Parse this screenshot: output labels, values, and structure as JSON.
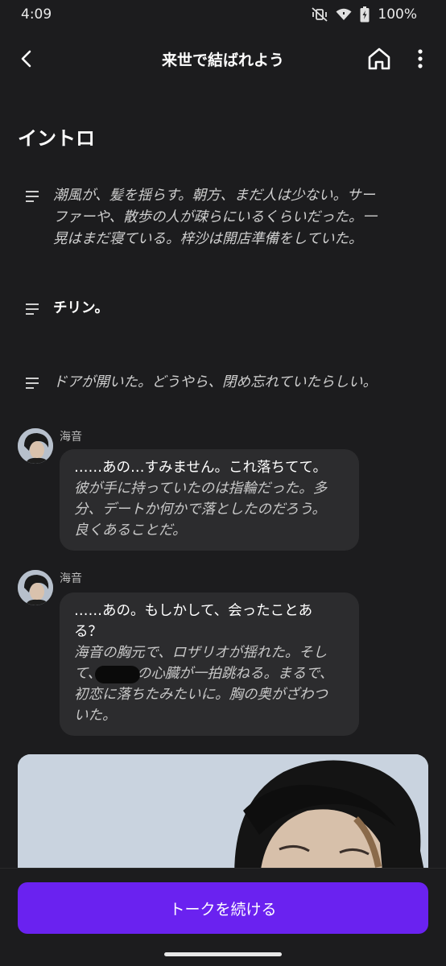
{
  "status_bar": {
    "time": "4:09",
    "battery": "100%",
    "icons": [
      "mute-vibrate-icon",
      "wifi-icon",
      "battery-icon"
    ]
  },
  "header": {
    "title": "来世で結ばれよう",
    "icons": [
      "back-arrow-icon",
      "home-icon",
      "more-vertical-icon"
    ]
  },
  "section": {
    "heading": "イントロ"
  },
  "narration": [
    {
      "lines": [
        "潮風が、髪を揺らす。朝方、まだ人は少ない。サー",
        "ファーや、散歩の人が疎らにいるくらいだった。一",
        "晃はまだ寝ている。梓沙は開店準備をしていた。"
      ]
    },
    {
      "lines": [
        "チリン。"
      ]
    },
    {
      "lines": [
        "ドアが開いた。どうやら、閉め忘れていたらしい。"
      ]
    }
  ],
  "messages": [
    {
      "speaker": "海音",
      "speech": [
        "……あの…すみません。これ落ちてて。"
      ],
      "action": [
        "彼が手に持っていたのは指輪だった。多",
        "分、デートか何かで落としたのだろう。",
        "良くあることだ。"
      ]
    },
    {
      "speaker": "海音",
      "speech": [
        "……あの。もしかして、会ったことあ",
        "る？"
      ],
      "action": [
        "海音の胸元で、ロザリオが揺れた。そし",
        "て、　　　の心臓が一拍跳ねる。まるで、",
        "初恋に落ちたみたいに。胸の奥がざわつ",
        "いた。"
      ]
    }
  ],
  "cta": {
    "label": "トークを続ける"
  },
  "colors": {
    "background": "#1c1c1e",
    "bubble": "#2c2c2e",
    "accent": "#6a22f0"
  }
}
